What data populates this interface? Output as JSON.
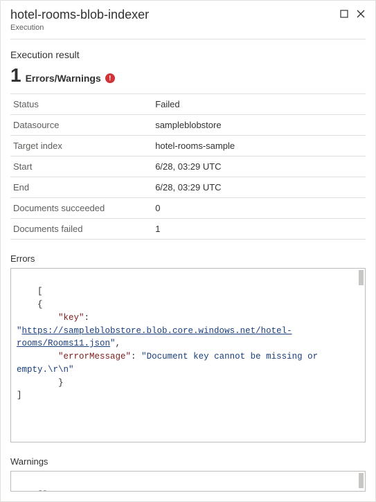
{
  "header": {
    "title": "hotel-rooms-blob-indexer",
    "subtitle": "Execution"
  },
  "result": {
    "heading": "Execution result",
    "count": "1",
    "count_label": "Errors/Warnings",
    "badge": "!"
  },
  "details": [
    {
      "key": "Status",
      "value": "Failed"
    },
    {
      "key": "Datasource",
      "value": "sampleblobstore"
    },
    {
      "key": "Target index",
      "value": "hotel-rooms-sample"
    },
    {
      "key": "Start",
      "value": "6/28, 03:29 UTC"
    },
    {
      "key": "End",
      "value": "6/28, 03:29 UTC"
    },
    {
      "key": "Documents succeeded",
      "value": "0"
    },
    {
      "key": "Documents failed",
      "value": "1"
    }
  ],
  "errors": {
    "heading": "Errors",
    "open": "[",
    "brace_open": "    {",
    "key_label": "\"key\"",
    "key_sep": ": ",
    "key_q1": "\"",
    "key_link": "https://sampleblobstore.blob.core.windows.net/hotel-rooms/Rooms11.json",
    "key_q2": "\"",
    "comma": ",",
    "msg_label": "\"errorMessage\"",
    "msg_value": "\"Document key cannot be missing or empty.\\r\\n\"",
    "brace_close": "        }",
    "close": "]"
  },
  "warnings": {
    "heading": "Warnings",
    "body": "[]"
  }
}
